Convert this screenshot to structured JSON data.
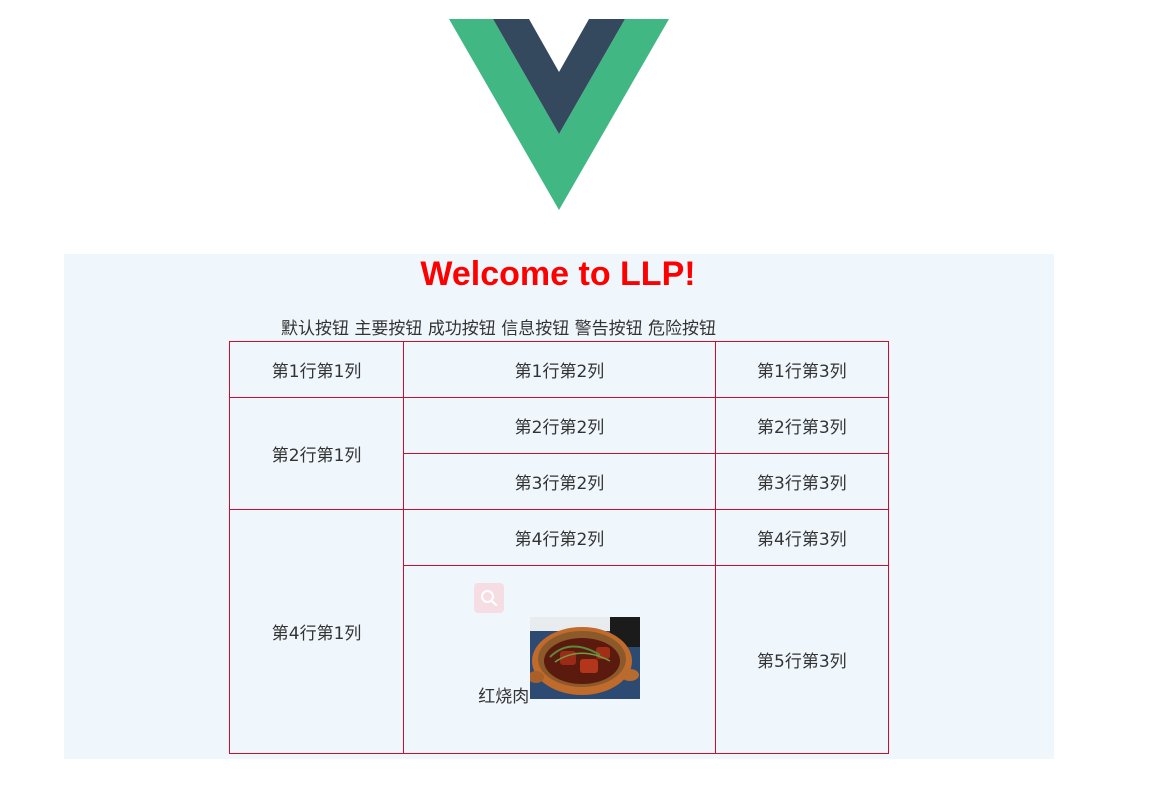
{
  "title": "Welcome to LLP!",
  "buttons": [
    "默认按钮",
    "主要按钮",
    "成功按钮",
    "信息按钮",
    "警告按钮",
    "危险按钮"
  ],
  "table": {
    "r1c1": "第1行第1列",
    "r1c2": "第1行第2列",
    "r1c3": "第1行第3列",
    "r2c1": "第2行第1列",
    "r2c2": "第2行第2列",
    "r2c3": "第2行第3列",
    "r3c2": "第3行第2列",
    "r3c3": "第3行第3列",
    "r4c1": "第4行第1列",
    "r4c2": "第4行第2列",
    "r4c3": "第4行第3列",
    "r5c3": "第5行第3列",
    "dish_label": "红烧肉"
  },
  "icons": {
    "logo": "vue-logo",
    "search": "search-icon",
    "dish": "braised-pork-image"
  },
  "colors": {
    "title": "#ff0000",
    "vue_green": "#41b883",
    "vue_dark": "#34495e",
    "table_border": "#c8102e",
    "panel_bg": "#eff7fd"
  }
}
